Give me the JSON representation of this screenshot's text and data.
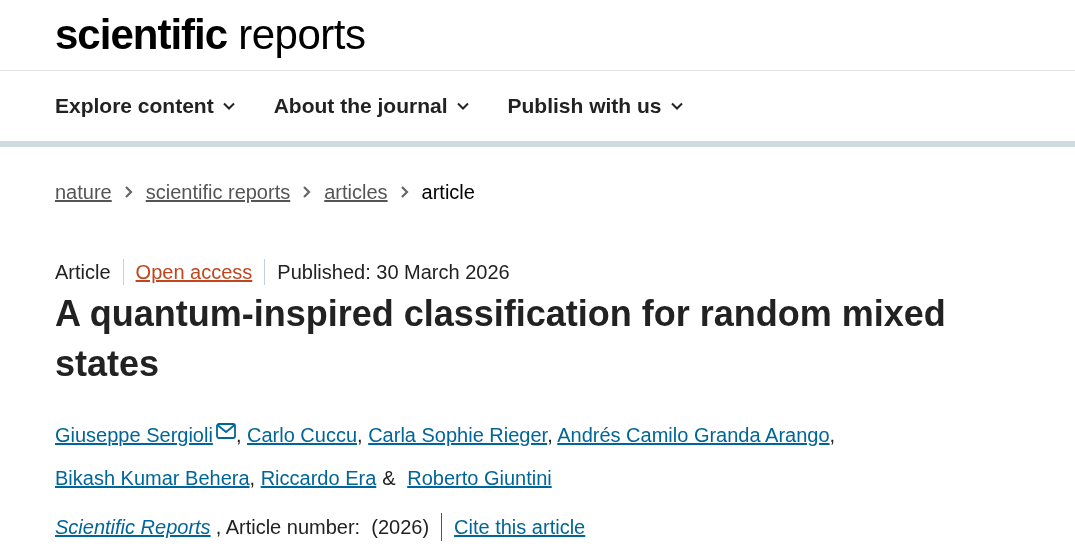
{
  "logo": "**scientific** reports",
  "nav": [
    {
      "label": "Explore content"
    },
    {
      "label": "About the journal"
    },
    {
      "label": "Publish with us"
    }
  ],
  "breadcrumbs": [
    {
      "label": "nature",
      "current": false
    },
    {
      "label": "scientific reports",
      "current": false
    },
    {
      "label": "articles",
      "current": false
    },
    {
      "label": "article",
      "current": true
    }
  ],
  "meta": {
    "type": "Article",
    "access": "Open access",
    "published": "Published: 30 March 2026"
  },
  "title": "A quantum-inspired classification for random mixed states",
  "authors": [
    {
      "name": "Giuseppe Sergioli",
      "email": true,
      "separator": ","
    },
    {
      "name": "Carlo Cuccu",
      "email": false,
      "separator": ","
    },
    {
      "name": "Carla Sophie Rieger",
      "email": false,
      "separator": ","
    },
    {
      "name": "Andrés Camilo Granda Arango",
      "email": false,
      "separator": ","
    },
    {
      "name": "Bikash Kumar Behera",
      "email": false,
      "separator": ","
    },
    {
      "name": "Riccardo Era",
      "email": false,
      "separator": "&"
    },
    {
      "name": "Roberto Giuntini",
      "email": false
    }
  ],
  "citation": {
    "journal": "Scientific Reports",
    "article_number": ", Article number:  (2026)",
    "cite": "Cite this article"
  }
}
